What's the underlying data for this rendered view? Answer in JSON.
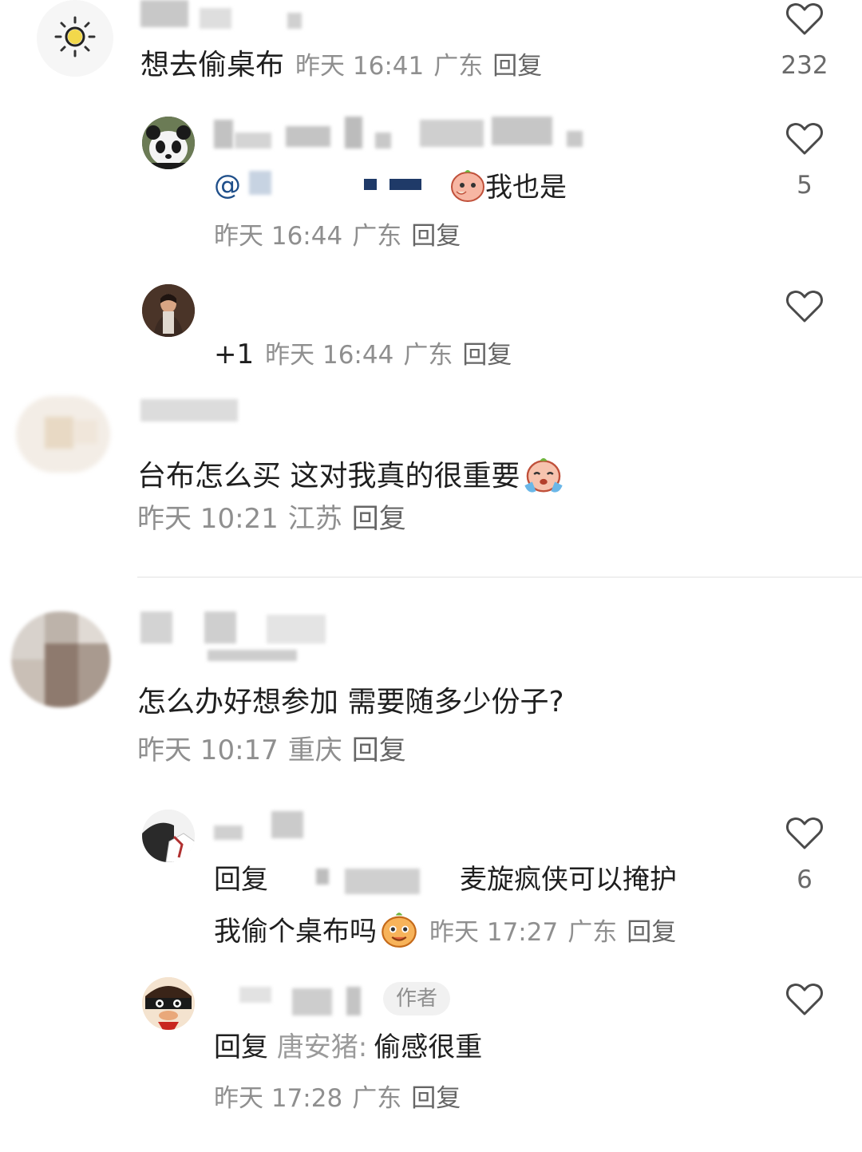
{
  "comments": [
    {
      "text": "想去偷桌布",
      "time": "昨天 16:41",
      "location": "广东",
      "reply_label": "回复",
      "likes": "232",
      "replies": [
        {
          "prefix": "@",
          "text": "我也是",
          "time": "昨天 16:44",
          "location": "广东",
          "reply_label": "回复",
          "likes": "5"
        },
        {
          "text": "+1",
          "time": "昨天 16:44",
          "location": "广东",
          "reply_label": "回复",
          "likes": ""
        }
      ]
    },
    {
      "text": "台布怎么买 这对我真的很重要",
      "time": "昨天 10:21",
      "location": "江苏",
      "reply_label": "回复"
    },
    {
      "text": "怎么办好想参加 需要随多少份子?",
      "time": "昨天 10:17",
      "location": "重庆",
      "reply_label": "回复",
      "replies": [
        {
          "prefix": "回复",
          "text_line1": "麦旋疯侠可以掩护",
          "text_line2": "我偷个桌布吗",
          "time": "昨天 17:27",
          "location": "广东",
          "reply_label": "回复",
          "likes": "6"
        },
        {
          "badge": "作者",
          "prefix": "回复",
          "mention": "唐安猪:",
          "text": "偷感很重",
          "time": "昨天 17:28",
          "location": "广东",
          "reply_label": "回复",
          "likes": ""
        }
      ]
    }
  ],
  "icons": {
    "like": "heart-outline-icon",
    "emoji_shy": "shy-face-emoji",
    "emoji_cry": "crying-face-emoji",
    "emoji_smile": "smiling-face-emoji"
  },
  "colors": {
    "text": "#1f1f1f",
    "meta": "#8f8f8f",
    "heart_stroke": "#4a4a4a"
  }
}
